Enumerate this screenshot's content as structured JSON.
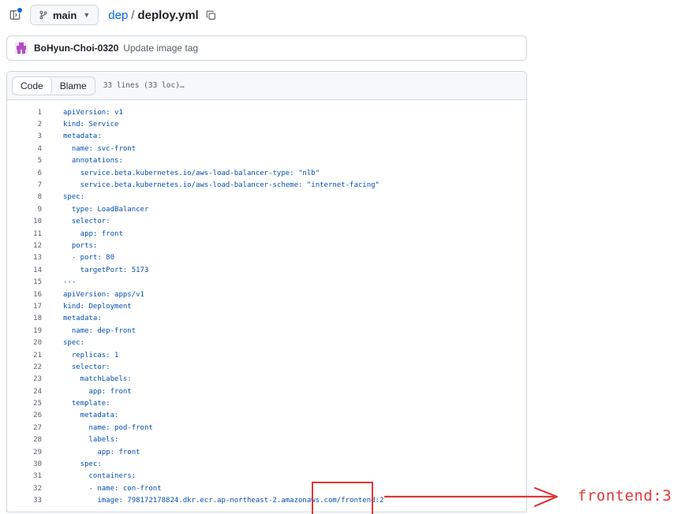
{
  "header": {
    "branch": "main",
    "repo": "dep",
    "separator": "/",
    "file": "deploy.yml"
  },
  "commit": {
    "author": "BoHyun-Choi-0320",
    "message": "Update image tag"
  },
  "code_view": {
    "tabs": [
      "Code",
      "Blame"
    ],
    "lines_info": "33 lines (33 loc)…",
    "lines": [
      {
        "n": "1",
        "text": "apiVersion: v1"
      },
      {
        "n": "2",
        "text": "kind: Service"
      },
      {
        "n": "3",
        "text": "metadata:"
      },
      {
        "n": "4",
        "text": "  name: svc-front"
      },
      {
        "n": "5",
        "text": "  annotations:"
      },
      {
        "n": "6",
        "text": "    service.beta.kubernetes.io/aws-load-balancer-type: \"nlb\""
      },
      {
        "n": "7",
        "text": "    service.beta.kubernetes.io/aws-load-balancer-scheme: \"internet-facing\""
      },
      {
        "n": "8",
        "text": "spec:"
      },
      {
        "n": "9",
        "text": "  type: LoadBalancer"
      },
      {
        "n": "10",
        "text": "  selector:"
      },
      {
        "n": "11",
        "text": "    app: front"
      },
      {
        "n": "12",
        "text": "  ports:"
      },
      {
        "n": "13",
        "text": "  - port: 80"
      },
      {
        "n": "14",
        "text": "    targetPort: 5173"
      },
      {
        "n": "15",
        "text": "---"
      },
      {
        "n": "16",
        "text": "apiVersion: apps/v1"
      },
      {
        "n": "17",
        "text": "kind: Deployment"
      },
      {
        "n": "18",
        "text": "metadata:"
      },
      {
        "n": "19",
        "text": "  name: dep-front"
      },
      {
        "n": "20",
        "text": "spec:"
      },
      {
        "n": "21",
        "text": "  replicas: 1"
      },
      {
        "n": "22",
        "text": "  selector:"
      },
      {
        "n": "23",
        "text": "    matchLabels:"
      },
      {
        "n": "24",
        "text": "      app: front"
      },
      {
        "n": "25",
        "text": "  template:"
      },
      {
        "n": "26",
        "text": "    metadata:"
      },
      {
        "n": "27",
        "text": "      name: pod-front"
      },
      {
        "n": "28",
        "text": "      labels:"
      },
      {
        "n": "29",
        "text": "        app: front"
      },
      {
        "n": "30",
        "text": "    spec:"
      },
      {
        "n": "31",
        "text": "      containers:"
      },
      {
        "n": "32",
        "text": "      - name: con-front"
      },
      {
        "n": "33",
        "text": "        image: 798172178824.dkr.ecr.ap-northeast-2.amazonaws.com/frontend:2"
      }
    ]
  },
  "annotation": {
    "text": "frontend:3"
  },
  "colors": {
    "link": "#0969da",
    "code_text": "#0550ae",
    "annotation": "#e23636"
  }
}
